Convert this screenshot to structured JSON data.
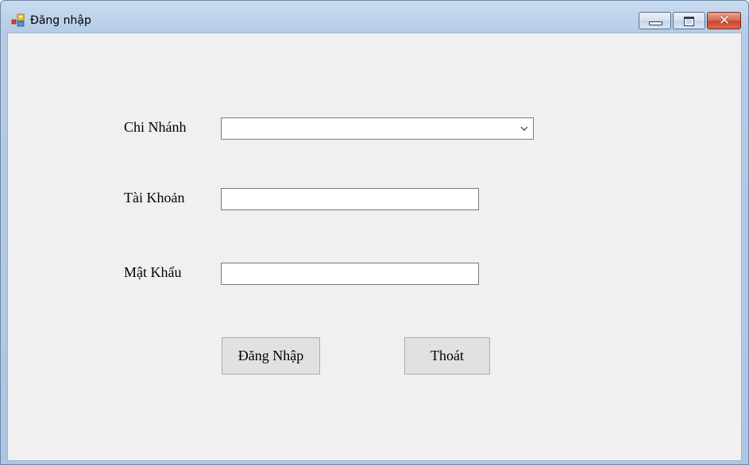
{
  "window": {
    "title": "Đăng nhập",
    "app_icon": "winforms-app-icon",
    "controls": {
      "minimize": "minimize-icon",
      "maximize": "maximize-icon",
      "close": "close-icon"
    },
    "colors": {
      "frame": "#b5cbe6",
      "client_background": "#f0f0f0",
      "close_button": "#c9472e",
      "button_face": "#e1e1e1"
    }
  },
  "form": {
    "branch_label": "Chi Nhánh",
    "branch_value": "",
    "account_label": "Tài Khoản",
    "account_value": "",
    "password_label": "Mật Khẩu",
    "password_value": "",
    "login_button": "Đăng Nhập",
    "exit_button": "Thoát"
  }
}
